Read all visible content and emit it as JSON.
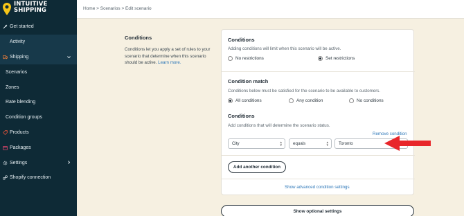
{
  "logo": {
    "line1": "INTUITIVE",
    "line2": "SHIPPING"
  },
  "nav": {
    "items": [
      {
        "label": "Get started",
        "icon": "rocket-icon"
      },
      {
        "label": "Activity"
      },
      {
        "label": "Shipping",
        "icon": "truck-icon"
      },
      {
        "label": "Scenarios"
      },
      {
        "label": "Zones"
      },
      {
        "label": "Rate blending"
      },
      {
        "label": "Condition groups"
      },
      {
        "label": "Products",
        "icon": "tag-icon"
      },
      {
        "label": "Packages",
        "icon": "box-icon"
      },
      {
        "label": "Settings",
        "icon": "gear-icon"
      },
      {
        "label": "Shopify connection",
        "icon": "link-icon"
      }
    ]
  },
  "breadcrumb": "Home > Scenarios > Edit scenario",
  "desc": {
    "title": "Conditions",
    "text": "Conditions let you apply a set of rules to your scenario that determine when this scenario should be active.",
    "link": "Learn more."
  },
  "restrictions": {
    "title": "Conditions",
    "subtitle": "Adding conditions will limit when this scenario will be active.",
    "options": [
      "No restrictions",
      "Set restrictions"
    ],
    "selected": "Set restrictions"
  },
  "match": {
    "title": "Condition match",
    "subtitle": "Conditions below must be satisfied for the scenario to be available to customers.",
    "options": [
      "All conditions",
      "Any condition",
      "No conditions"
    ],
    "selected": "All conditions"
  },
  "conditions": {
    "title": "Conditions",
    "subtitle": "Add conditions that will determine the scenario status.",
    "remove_label": "Remove condition",
    "field_value": "City",
    "operator_value": "equals",
    "text_value": "Toronto",
    "add_label": "Add another condition",
    "advanced_label": "Show advanced condition settings"
  },
  "optional_label": "Show optional settings",
  "colors": {
    "sidebar": "#0e2a36",
    "page_bg": "#f6f0e1",
    "link": "#2d77b8",
    "arrow": "#e8262a",
    "logo_pin": "#f5c518"
  }
}
